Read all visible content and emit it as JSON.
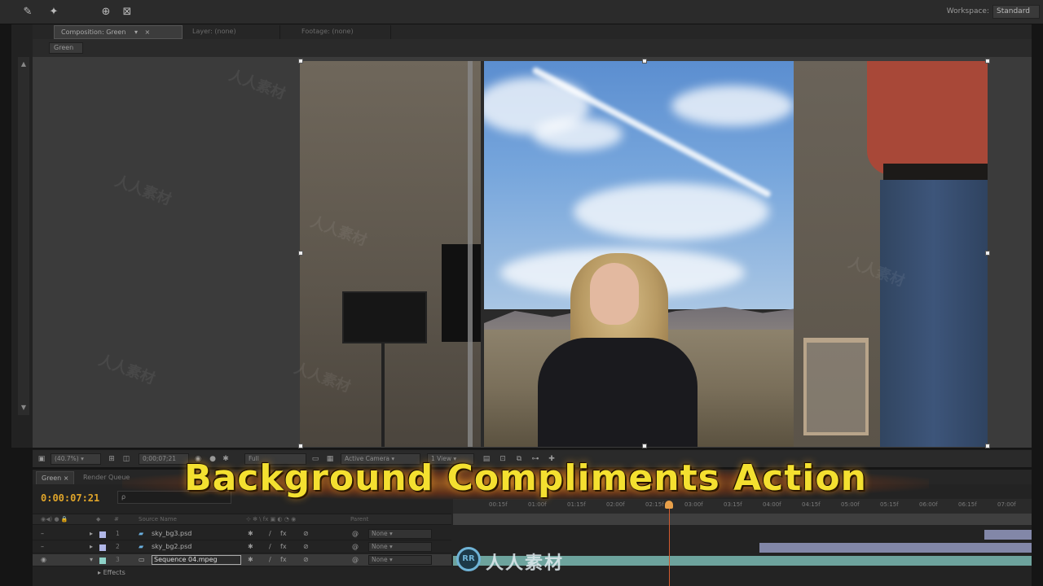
{
  "topbar": {
    "workspace_label": "Workspace:",
    "workspace_value": "Standard"
  },
  "viewer_tabs": [
    {
      "label": "Composition: Green",
      "active": true
    },
    {
      "label": "Layer: (none)",
      "active": false
    },
    {
      "label": "Footage: (none)",
      "active": false
    }
  ],
  "viewer_subbar": {
    "chip": "Green"
  },
  "viewer_toolbar": {
    "zoom": "(40.7%)",
    "timecode": "0;00;07;21",
    "resolution": "Full",
    "camera": "Active Camera",
    "views": "1 View"
  },
  "timeline": {
    "tabs": [
      {
        "label": "Green",
        "active": true
      },
      {
        "label": "Render Queue",
        "active": false
      }
    ],
    "timecode": "0:00:07:21",
    "search_placeholder": "ρ",
    "columns": {
      "source_name": "Source Name",
      "mode": "Parent"
    },
    "ruler_ticks": [
      "00:15f",
      "01:00f",
      "01:15f",
      "02:00f",
      "02:15f",
      "03:00f",
      "03:15f",
      "04:00f",
      "04:15f",
      "05:00f",
      "05:15f",
      "06:00f",
      "06:15f",
      "07:00f",
      "07:15f"
    ],
    "layers": [
      {
        "num": "1",
        "name": "sky_bg3.psd",
        "mode": "None",
        "selected": false,
        "color": "#b0b6e6"
      },
      {
        "num": "2",
        "name": "sky_bg2.psd",
        "mode": "None",
        "selected": false,
        "color": "#b0b6e6"
      },
      {
        "num": "3",
        "name": "Sequence 04.mpeg",
        "mode": "None",
        "selected": true,
        "color": "#8ed2c8"
      }
    ],
    "effects_label": "Effects"
  },
  "caption": {
    "text": "Background Compliments Action"
  },
  "watermark": {
    "text": "人人素材",
    "logo": "RR"
  }
}
